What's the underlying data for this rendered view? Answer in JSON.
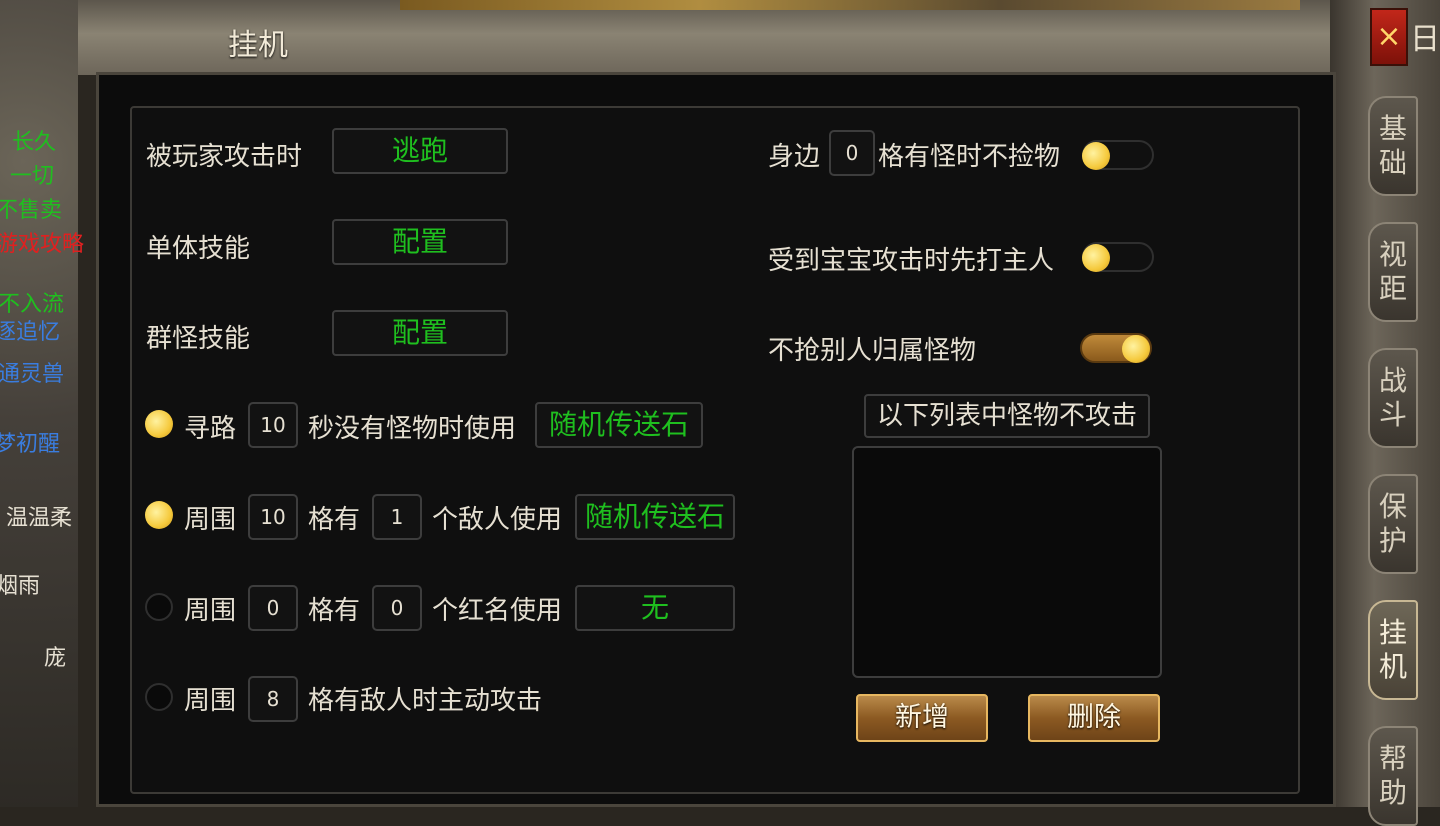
{
  "window": {
    "title": "挂机",
    "close_label": "×",
    "corner_char": "日"
  },
  "side_tabs": [
    {
      "label": "基础",
      "active": false
    },
    {
      "label": "视距",
      "active": false
    },
    {
      "label": "战斗",
      "active": false
    },
    {
      "label": "保护",
      "active": false
    },
    {
      "label": "挂机",
      "active": true
    },
    {
      "label": "帮助",
      "active": false
    }
  ],
  "left_texts": [
    {
      "text": "长久",
      "color": "#1fbf1f"
    },
    {
      "text": "一切",
      "color": "#1fbf1f"
    },
    {
      "text": "不售卖",
      "color": "#1fbf1f"
    },
    {
      "text": "游戏攻略",
      "color": "#e02020"
    },
    {
      "text": "不入流",
      "color": "#1fbf1f"
    },
    {
      "text": "逐追忆",
      "color": "#3a7de0"
    },
    {
      "text": "通灵兽",
      "color": "#3a7de0"
    },
    {
      "text": "梦初醒",
      "color": "#3a7de0"
    },
    {
      "text": "温温柔",
      "color": "#e6e0d2"
    },
    {
      "text": "烟雨",
      "color": "#e6e0d2"
    },
    {
      "text": "庞",
      "color": "#e6e0d2"
    }
  ],
  "settings": {
    "player_attack": {
      "label": "被玩家攻击时",
      "button": "逃跑"
    },
    "single_skill": {
      "label": "单体技能",
      "button": "配置"
    },
    "group_skill": {
      "label": "群怪技能",
      "button": "配置"
    },
    "pathfind": {
      "enabled": true,
      "label": "寻路",
      "seconds": "10",
      "text": "秒没有怪物时使用",
      "item": "随机传送石"
    },
    "surround_enemy": {
      "enabled": true,
      "label": "周围",
      "range": "10",
      "text1": "格有",
      "count": "1",
      "text2": "个敌人使用",
      "item": "随机传送石"
    },
    "surround_red": {
      "enabled": false,
      "label": "周围",
      "range": "0",
      "text1": "格有",
      "count": "0",
      "text2": "个红名使用",
      "item": "无"
    },
    "auto_attack": {
      "enabled": false,
      "label": "周围",
      "range": "8",
      "text": "格有敌人时主动攻击"
    }
  },
  "right_settings": {
    "no_pickup": {
      "prefix": "身边",
      "range": "0",
      "suffix": "格有怪时不捡物",
      "enabled": false
    },
    "attack_master": {
      "label": "受到宝宝攻击时先打主人",
      "enabled": false
    },
    "no_steal": {
      "label": "不抢别人归属怪物",
      "enabled": true
    }
  },
  "monster_list": {
    "title": "以下列表中怪物不攻击",
    "items": [],
    "add_label": "新增",
    "delete_label": "删除"
  }
}
